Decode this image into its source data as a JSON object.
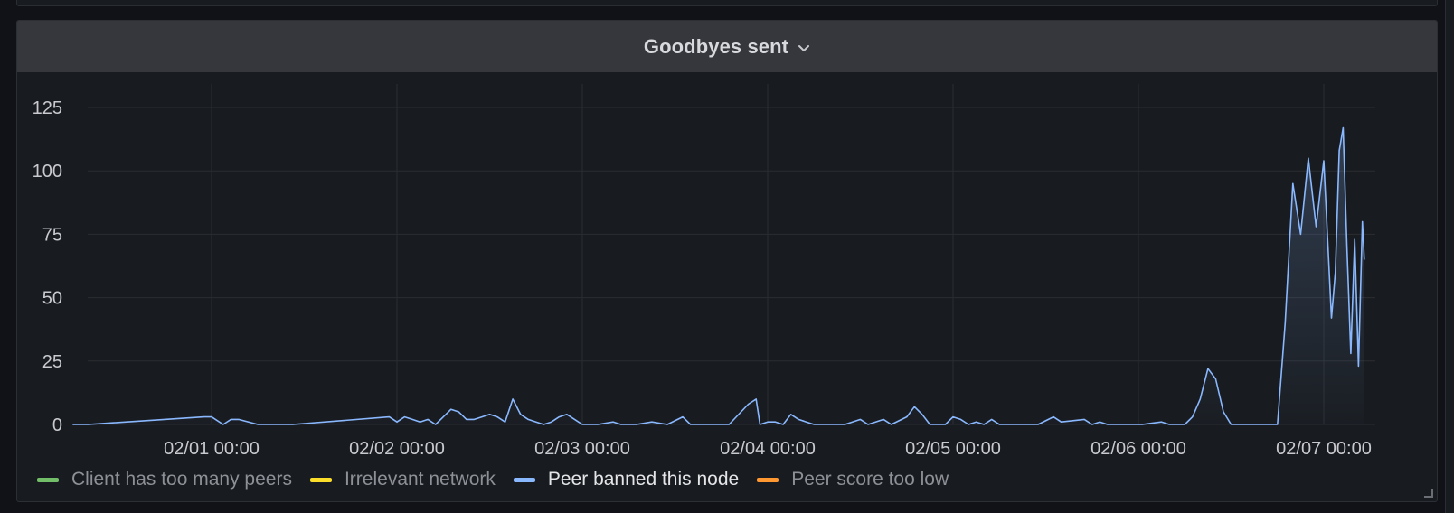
{
  "panel": {
    "title": "Goodbyes sent"
  },
  "colors": {
    "background": "#181b1f",
    "header": "#35373d",
    "grid": "#2a2c31",
    "tick_text": "#c9cacf"
  },
  "icons": {
    "title_menu": "chevron-down-icon",
    "resize": "resize-handle-icon"
  },
  "chart_data": {
    "type": "line",
    "title": "Goodbyes sent",
    "xlabel": "",
    "ylabel": "",
    "x_range": [
      "01/31 06:00",
      "02/07 02:30"
    ],
    "ylim": [
      0,
      130
    ],
    "y_ticks": [
      0,
      25,
      50,
      75,
      100,
      125
    ],
    "y_tick_labels": [
      "0",
      "25",
      "50",
      "75",
      "100",
      "125"
    ],
    "x_ticks": [
      "02/01 00:00",
      "02/02 00:00",
      "02/03 00:00",
      "02/04 00:00",
      "02/05 00:00",
      "02/06 00:00",
      "02/07 00:00"
    ],
    "grid": true,
    "legend_position": "bottom",
    "series": [
      {
        "name": "Client has too many peers",
        "color": "#73bf69",
        "points": []
      },
      {
        "name": "Irrelevant network",
        "color": "#fade2a",
        "points": []
      },
      {
        "name": "Peer banned this node",
        "color": "#8ab8ff",
        "fill": true,
        "points": [
          [
            "01/31 06:00",
            0
          ],
          [
            "01/31 07:00",
            0
          ],
          [
            "01/31 08:00",
            0
          ],
          [
            "01/31 23:00",
            3
          ],
          [
            "02/01 00:00",
            3
          ],
          [
            "02/01 01:30",
            0
          ],
          [
            "02/01 02:30",
            2
          ],
          [
            "02/01 03:30",
            2
          ],
          [
            "02/01 06:00",
            0
          ],
          [
            "02/01 08:30",
            0
          ],
          [
            "02/01 10:30",
            0
          ],
          [
            "02/01 23:00",
            3
          ],
          [
            "02/02 00:00",
            1
          ],
          [
            "02/02 01:00",
            3
          ],
          [
            "02/02 02:00",
            2
          ],
          [
            "02/02 03:00",
            1
          ],
          [
            "02/02 04:00",
            2
          ],
          [
            "02/02 05:00",
            0
          ],
          [
            "02/02 06:00",
            3
          ],
          [
            "02/02 07:00",
            6
          ],
          [
            "02/02 08:00",
            5
          ],
          [
            "02/02 09:00",
            2
          ],
          [
            "02/02 10:00",
            2
          ],
          [
            "02/02 11:00",
            3
          ],
          [
            "02/02 12:00",
            4
          ],
          [
            "02/02 13:00",
            3
          ],
          [
            "02/02 14:00",
            1
          ],
          [
            "02/02 15:00",
            10
          ],
          [
            "02/02 16:00",
            4
          ],
          [
            "02/02 17:00",
            2
          ],
          [
            "02/02 18:00",
            1
          ],
          [
            "02/02 19:00",
            0
          ],
          [
            "02/02 20:00",
            1
          ],
          [
            "02/02 21:00",
            3
          ],
          [
            "02/02 22:00",
            4
          ],
          [
            "02/02 23:00",
            2
          ],
          [
            "02/03 00:00",
            0
          ],
          [
            "02/03 02:00",
            0
          ],
          [
            "02/03 04:00",
            1
          ],
          [
            "02/03 05:00",
            0
          ],
          [
            "02/03 07:00",
            0
          ],
          [
            "02/03 09:00",
            1
          ],
          [
            "02/03 11:00",
            0
          ],
          [
            "02/03 13:00",
            3
          ],
          [
            "02/03 14:00",
            0
          ],
          [
            "02/03 17:00",
            0
          ],
          [
            "02/03 19:00",
            0
          ],
          [
            "02/03 21:30",
            8
          ],
          [
            "02/03 22:30",
            10
          ],
          [
            "02/03 23:00",
            0
          ],
          [
            "02/04 00:00",
            1
          ],
          [
            "02/04 01:00",
            1
          ],
          [
            "02/04 02:00",
            0
          ],
          [
            "02/04 03:00",
            4
          ],
          [
            "02/04 04:00",
            2
          ],
          [
            "02/04 05:00",
            1
          ],
          [
            "02/04 06:00",
            0
          ],
          [
            "02/04 08:00",
            0
          ],
          [
            "02/04 10:00",
            0
          ],
          [
            "02/04 12:00",
            2
          ],
          [
            "02/04 13:00",
            0
          ],
          [
            "02/04 15:00",
            2
          ],
          [
            "02/04 16:00",
            0
          ],
          [
            "02/04 18:00",
            3
          ],
          [
            "02/04 19:00",
            7
          ],
          [
            "02/04 20:00",
            4
          ],
          [
            "02/04 21:00",
            0
          ],
          [
            "02/04 23:00",
            0
          ],
          [
            "02/05 00:00",
            3
          ],
          [
            "02/05 01:00",
            2
          ],
          [
            "02/05 02:00",
            0
          ],
          [
            "02/05 03:00",
            1
          ],
          [
            "02/05 04:00",
            0
          ],
          [
            "02/05 05:00",
            2
          ],
          [
            "02/05 06:00",
            0
          ],
          [
            "02/05 08:00",
            0
          ],
          [
            "02/05 11:00",
            0
          ],
          [
            "02/05 13:00",
            3
          ],
          [
            "02/05 14:00",
            1
          ],
          [
            "02/05 17:00",
            2
          ],
          [
            "02/05 18:00",
            0
          ],
          [
            "02/05 19:00",
            1
          ],
          [
            "02/05 20:00",
            0
          ],
          [
            "02/05 23:00",
            0
          ],
          [
            "02/06 00:30",
            0
          ],
          [
            "02/06 03:00",
            1
          ],
          [
            "02/06 04:00",
            0
          ],
          [
            "02/06 06:00",
            0
          ],
          [
            "02/06 07:00",
            3
          ],
          [
            "02/06 08:00",
            10
          ],
          [
            "02/06 09:00",
            22
          ],
          [
            "02/06 10:00",
            18
          ],
          [
            "02/06 11:00",
            5
          ],
          [
            "02/06 12:00",
            0
          ],
          [
            "02/06 14:00",
            0
          ],
          [
            "02/06 16:00",
            0
          ],
          [
            "02/06 18:00",
            0
          ],
          [
            "02/06 19:00",
            40
          ],
          [
            "02/06 20:00",
            95
          ],
          [
            "02/06 21:00",
            75
          ],
          [
            "02/06 22:00",
            105
          ],
          [
            "02/06 23:00",
            78
          ],
          [
            "02/07 00:00",
            104
          ],
          [
            "02/07 01:00",
            42
          ],
          [
            "02/07 01:30",
            60
          ],
          [
            "02/07 02:00",
            108
          ],
          [
            "02/07 02:30",
            117
          ],
          [
            "02/07 03:00",
            70
          ],
          [
            "02/07 03:30",
            28
          ],
          [
            "02/07 04:00",
            73
          ],
          [
            "02/07 04:30",
            23
          ],
          [
            "02/07 05:00",
            80
          ],
          [
            "02/07 05:15",
            65
          ]
        ]
      },
      {
        "name": "Peer score too low",
        "color": "#ff9830",
        "points": []
      }
    ]
  }
}
